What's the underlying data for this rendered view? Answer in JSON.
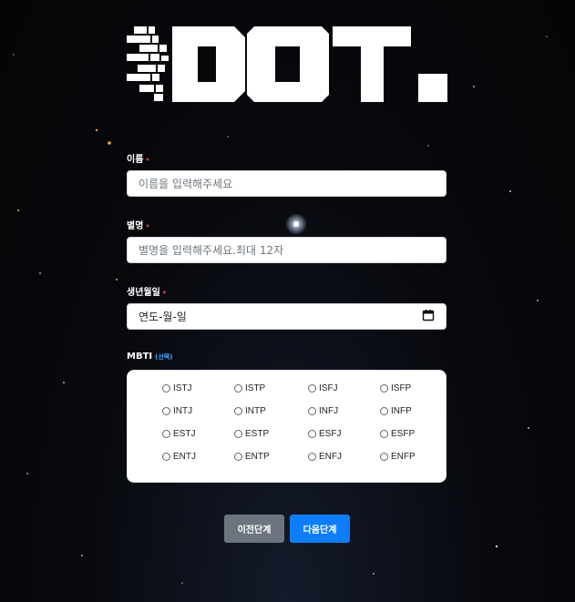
{
  "app": {
    "logo_text": "DOT."
  },
  "form": {
    "name": {
      "label": "이름",
      "required_mark": "•",
      "placeholder": "이름을 입력해주세요"
    },
    "nickname": {
      "label": "별명",
      "required_mark": "•",
      "placeholder": "별명을 입력해주세요.최대 12자"
    },
    "birthdate": {
      "label": "생년월일",
      "required_mark": "•",
      "value_display": "연도-월-일"
    },
    "mbti": {
      "label": "MBTI",
      "optional_note": "(선택)",
      "options": [
        "ISTJ",
        "ISTP",
        "ISFJ",
        "ISFP",
        "INTJ",
        "INTP",
        "INFJ",
        "INFP",
        "ESTJ",
        "ESTP",
        "ESFJ",
        "ESFP",
        "ENTJ",
        "ENTP",
        "ENFJ",
        "ENFP"
      ]
    }
  },
  "buttons": {
    "prev_label": "이전단계",
    "next_label": "다음단계"
  },
  "colors": {
    "required": "#e03b3b",
    "optional": "#4fa3ff",
    "prev_button": "#6c757d",
    "next_button": "#0d7dfd"
  },
  "icons": {
    "date": "calendar-icon",
    "logo": "dot-logo"
  }
}
